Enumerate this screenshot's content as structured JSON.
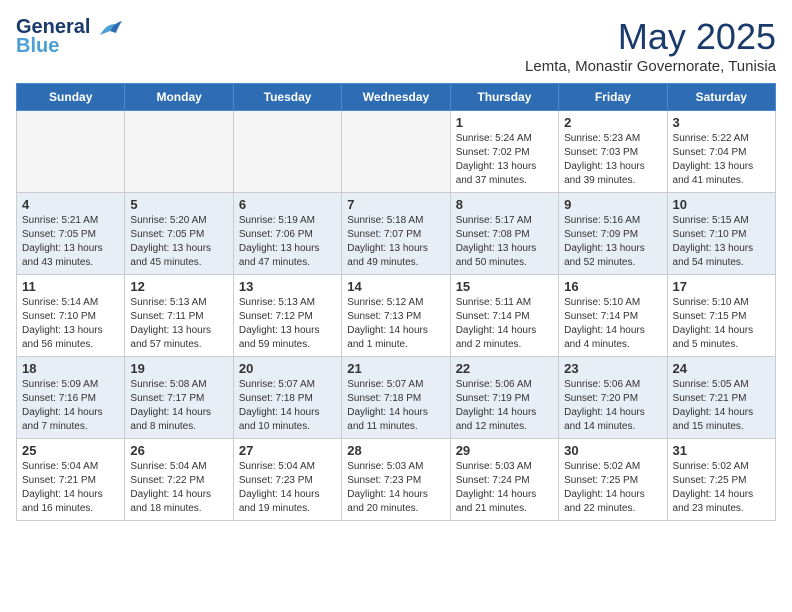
{
  "logo": {
    "line1": "General",
    "line2": "Blue"
  },
  "title": "May 2025",
  "location": "Lemta, Monastir Governorate, Tunisia",
  "days": [
    "Sunday",
    "Monday",
    "Tuesday",
    "Wednesday",
    "Thursday",
    "Friday",
    "Saturday"
  ],
  "weeks": [
    [
      {
        "num": "",
        "info": ""
      },
      {
        "num": "",
        "info": ""
      },
      {
        "num": "",
        "info": ""
      },
      {
        "num": "",
        "info": ""
      },
      {
        "num": "1",
        "info": "Sunrise: 5:24 AM\nSunset: 7:02 PM\nDaylight: 13 hours\nand 37 minutes."
      },
      {
        "num": "2",
        "info": "Sunrise: 5:23 AM\nSunset: 7:03 PM\nDaylight: 13 hours\nand 39 minutes."
      },
      {
        "num": "3",
        "info": "Sunrise: 5:22 AM\nSunset: 7:04 PM\nDaylight: 13 hours\nand 41 minutes."
      }
    ],
    [
      {
        "num": "4",
        "info": "Sunrise: 5:21 AM\nSunset: 7:05 PM\nDaylight: 13 hours\nand 43 minutes."
      },
      {
        "num": "5",
        "info": "Sunrise: 5:20 AM\nSunset: 7:05 PM\nDaylight: 13 hours\nand 45 minutes."
      },
      {
        "num": "6",
        "info": "Sunrise: 5:19 AM\nSunset: 7:06 PM\nDaylight: 13 hours\nand 47 minutes."
      },
      {
        "num": "7",
        "info": "Sunrise: 5:18 AM\nSunset: 7:07 PM\nDaylight: 13 hours\nand 49 minutes."
      },
      {
        "num": "8",
        "info": "Sunrise: 5:17 AM\nSunset: 7:08 PM\nDaylight: 13 hours\nand 50 minutes."
      },
      {
        "num": "9",
        "info": "Sunrise: 5:16 AM\nSunset: 7:09 PM\nDaylight: 13 hours\nand 52 minutes."
      },
      {
        "num": "10",
        "info": "Sunrise: 5:15 AM\nSunset: 7:10 PM\nDaylight: 13 hours\nand 54 minutes."
      }
    ],
    [
      {
        "num": "11",
        "info": "Sunrise: 5:14 AM\nSunset: 7:10 PM\nDaylight: 13 hours\nand 56 minutes."
      },
      {
        "num": "12",
        "info": "Sunrise: 5:13 AM\nSunset: 7:11 PM\nDaylight: 13 hours\nand 57 minutes."
      },
      {
        "num": "13",
        "info": "Sunrise: 5:13 AM\nSunset: 7:12 PM\nDaylight: 13 hours\nand 59 minutes."
      },
      {
        "num": "14",
        "info": "Sunrise: 5:12 AM\nSunset: 7:13 PM\nDaylight: 14 hours\nand 1 minute."
      },
      {
        "num": "15",
        "info": "Sunrise: 5:11 AM\nSunset: 7:14 PM\nDaylight: 14 hours\nand 2 minutes."
      },
      {
        "num": "16",
        "info": "Sunrise: 5:10 AM\nSunset: 7:14 PM\nDaylight: 14 hours\nand 4 minutes."
      },
      {
        "num": "17",
        "info": "Sunrise: 5:10 AM\nSunset: 7:15 PM\nDaylight: 14 hours\nand 5 minutes."
      }
    ],
    [
      {
        "num": "18",
        "info": "Sunrise: 5:09 AM\nSunset: 7:16 PM\nDaylight: 14 hours\nand 7 minutes."
      },
      {
        "num": "19",
        "info": "Sunrise: 5:08 AM\nSunset: 7:17 PM\nDaylight: 14 hours\nand 8 minutes."
      },
      {
        "num": "20",
        "info": "Sunrise: 5:07 AM\nSunset: 7:18 PM\nDaylight: 14 hours\nand 10 minutes."
      },
      {
        "num": "21",
        "info": "Sunrise: 5:07 AM\nSunset: 7:18 PM\nDaylight: 14 hours\nand 11 minutes."
      },
      {
        "num": "22",
        "info": "Sunrise: 5:06 AM\nSunset: 7:19 PM\nDaylight: 14 hours\nand 12 minutes."
      },
      {
        "num": "23",
        "info": "Sunrise: 5:06 AM\nSunset: 7:20 PM\nDaylight: 14 hours\nand 14 minutes."
      },
      {
        "num": "24",
        "info": "Sunrise: 5:05 AM\nSunset: 7:21 PM\nDaylight: 14 hours\nand 15 minutes."
      }
    ],
    [
      {
        "num": "25",
        "info": "Sunrise: 5:04 AM\nSunset: 7:21 PM\nDaylight: 14 hours\nand 16 minutes."
      },
      {
        "num": "26",
        "info": "Sunrise: 5:04 AM\nSunset: 7:22 PM\nDaylight: 14 hours\nand 18 minutes."
      },
      {
        "num": "27",
        "info": "Sunrise: 5:04 AM\nSunset: 7:23 PM\nDaylight: 14 hours\nand 19 minutes."
      },
      {
        "num": "28",
        "info": "Sunrise: 5:03 AM\nSunset: 7:23 PM\nDaylight: 14 hours\nand 20 minutes."
      },
      {
        "num": "29",
        "info": "Sunrise: 5:03 AM\nSunset: 7:24 PM\nDaylight: 14 hours\nand 21 minutes."
      },
      {
        "num": "30",
        "info": "Sunrise: 5:02 AM\nSunset: 7:25 PM\nDaylight: 14 hours\nand 22 minutes."
      },
      {
        "num": "31",
        "info": "Sunrise: 5:02 AM\nSunset: 7:25 PM\nDaylight: 14 hours\nand 23 minutes."
      }
    ]
  ]
}
